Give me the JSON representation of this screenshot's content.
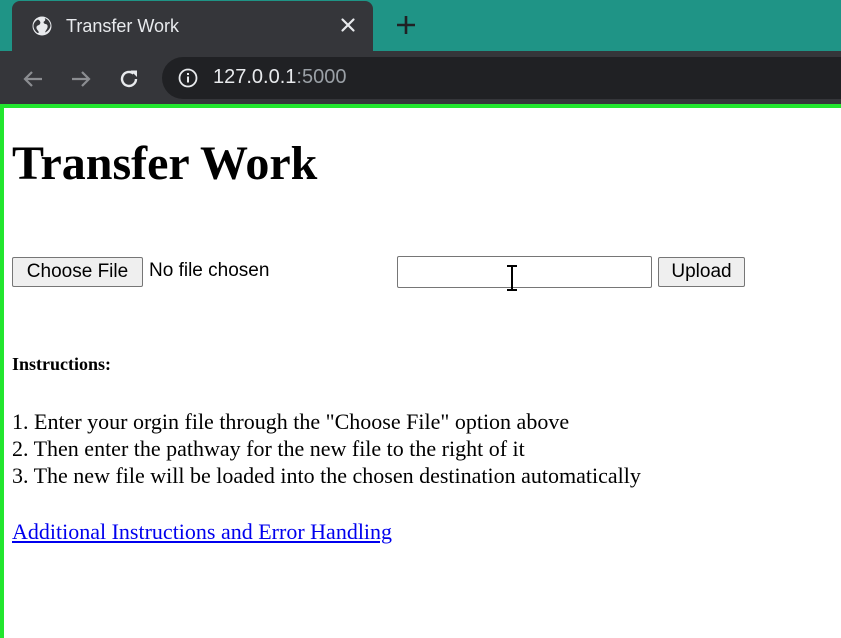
{
  "browser": {
    "tab_title": "Transfer Work",
    "url_host": "127.0.0.1",
    "url_port": ":5000",
    "icons": {
      "tab_favicon": "globe-icon",
      "tab_close": "close-icon",
      "new_tab": "plus-icon",
      "back": "back-arrow-icon",
      "forward": "forward-arrow-icon",
      "reload": "reload-icon",
      "site_info": "info-icon"
    },
    "colors": {
      "tabbar": "#1f9486",
      "toolbar": "#35363a",
      "frame": "#22e62e"
    }
  },
  "page": {
    "heading": "Transfer Work",
    "file_button_label": "Choose File",
    "file_status": "No file chosen",
    "path_input_value": "",
    "upload_label": "Upload",
    "instructions_heading": "Instructions:",
    "steps": [
      "1. Enter your orgin file through the \"Choose File\" option above",
      "2. Then enter the pathway for the new file to the right of it",
      "3. The new file will be loaded into the chosen destination automatically"
    ],
    "help_link": "Additional Instructions and Error Handling",
    "link_color": "#0000ee"
  }
}
